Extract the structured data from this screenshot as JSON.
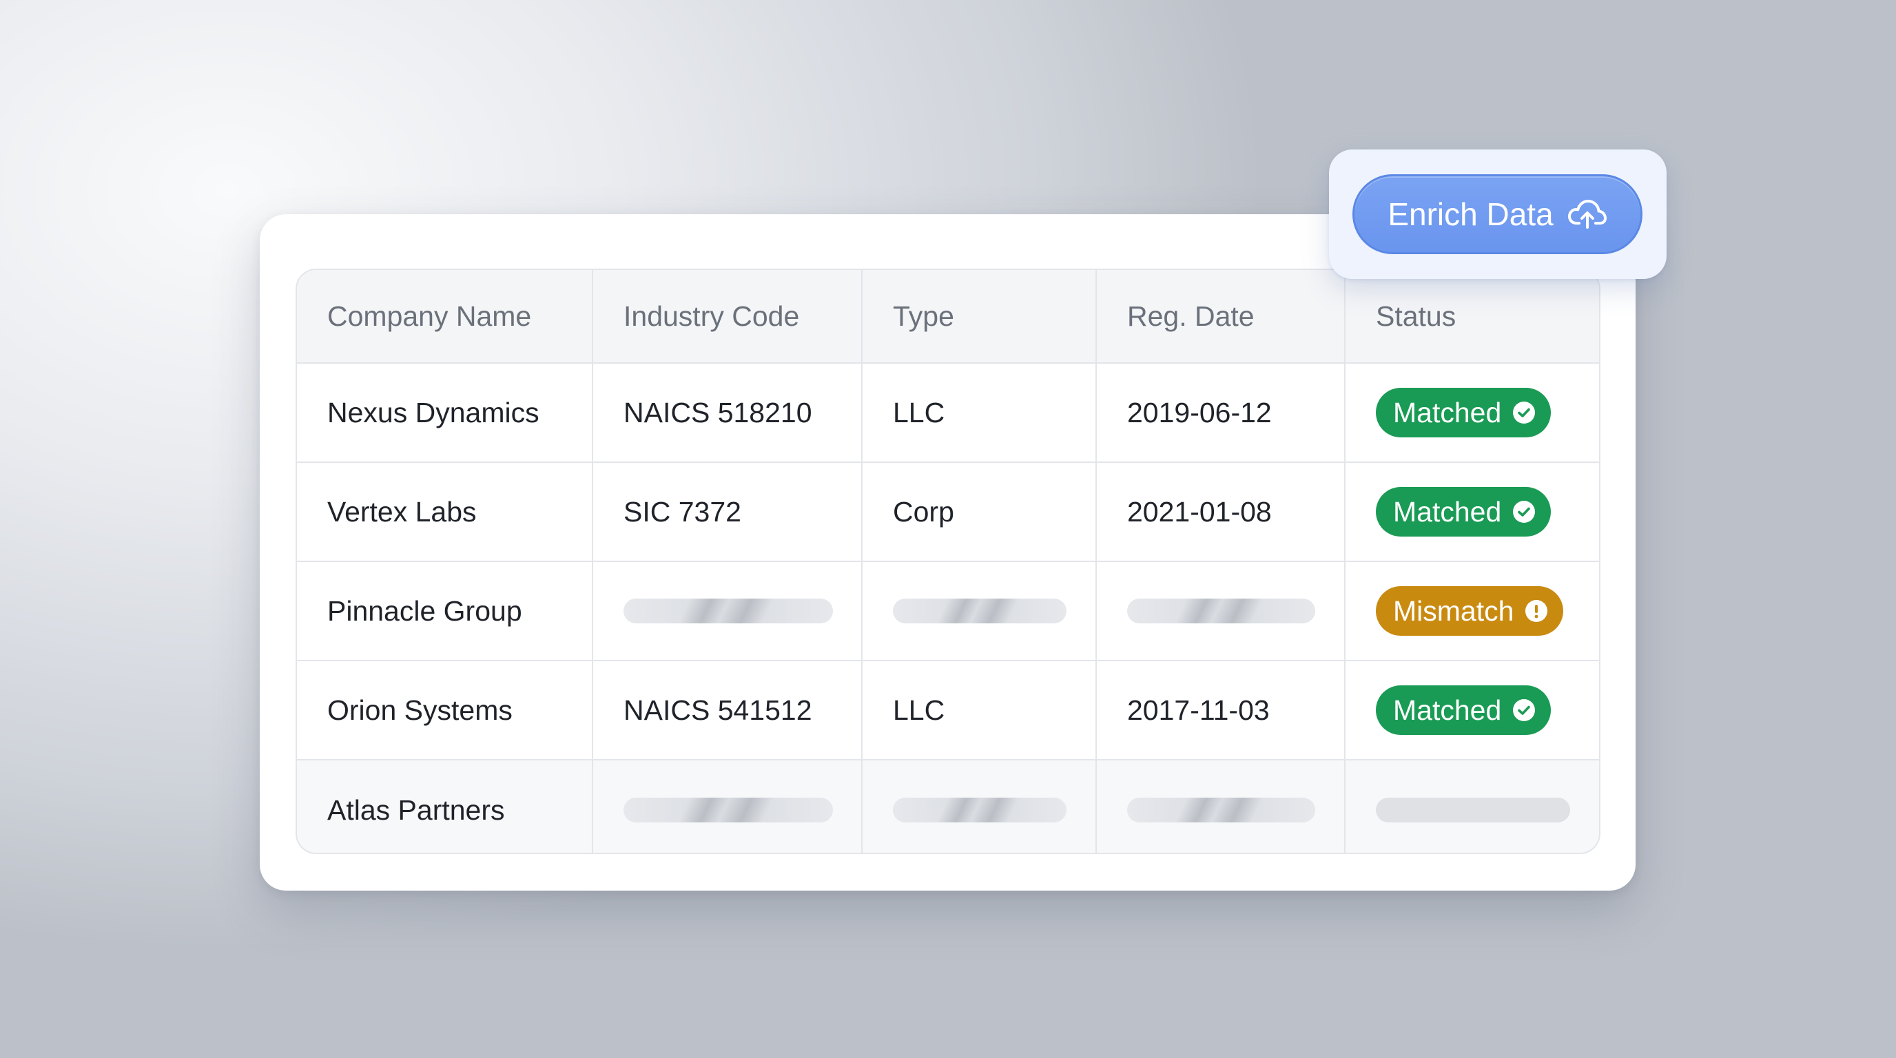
{
  "table": {
    "headers": [
      "Company Name",
      "Industry Code",
      "Type",
      "Reg. Date",
      "Status"
    ],
    "rows": [
      {
        "company": "Nexus Dynamics",
        "industry_code": "NAICS 518210",
        "type": "LLC",
        "reg_date": "2019-06-12",
        "status": "Matched",
        "loading": false
      },
      {
        "company": "Vertex Labs",
        "industry_code": "SIC 7372",
        "type": "Corp",
        "reg_date": "2021-01-08",
        "status": "Matched",
        "loading": false
      },
      {
        "company": "Pinnacle Group",
        "industry_code": null,
        "type": null,
        "reg_date": null,
        "status": "Mismatch",
        "loading": true
      },
      {
        "company": "Orion Systems",
        "industry_code": "NAICS 541512",
        "type": "LLC",
        "reg_date": "2017-11-03",
        "status": "Matched",
        "loading": false
      },
      {
        "company": "Atlas Partners",
        "industry_code": null,
        "type": null,
        "reg_date": null,
        "status": null,
        "loading": true
      }
    ]
  },
  "enrich_button": {
    "label": "Enrich Data",
    "icon": "cloud-upload-icon"
  },
  "status_styles": {
    "Matched": {
      "color": "#1a9b55",
      "icon": "check-circle-icon"
    },
    "Mismatch": {
      "color": "#c98a10",
      "icon": "exclamation-circle-icon"
    }
  },
  "colors": {
    "button_accent": "#6f98ef",
    "skeleton": "#e1e3e7"
  }
}
